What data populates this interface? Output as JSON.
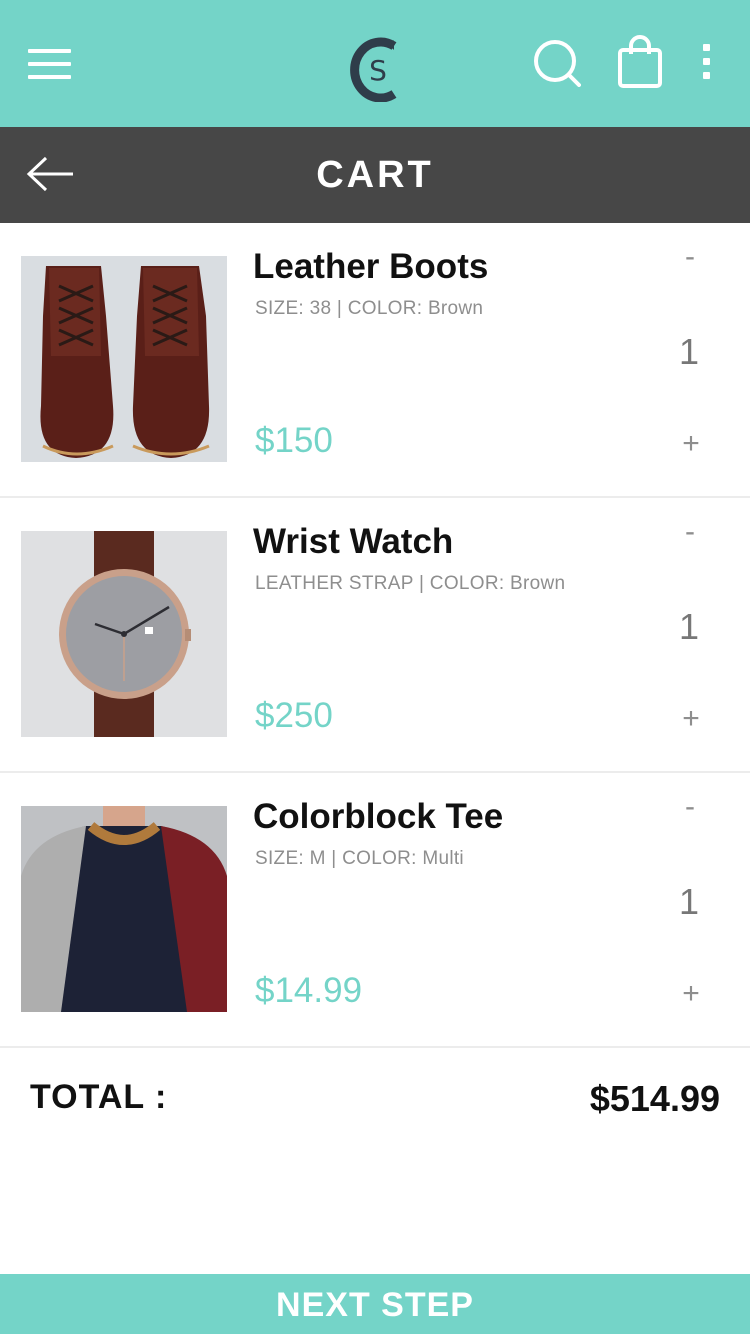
{
  "header": {
    "menu_icon": "hamburger-menu-icon",
    "logo_text": "S",
    "search_icon": "search-icon",
    "bag_icon": "shopping-bag-icon",
    "more_icon": "more-vertical-icon"
  },
  "titlebar": {
    "back_icon": "arrow-left-icon",
    "title": "CART"
  },
  "cart": {
    "items": [
      {
        "name": "Leather Boots",
        "meta": "SIZE: 38 | COLOR: Brown",
        "price": "$150",
        "quantity": "1",
        "minus": "-",
        "plus": "+"
      },
      {
        "name": "Wrist Watch",
        "meta": "LEATHER STRAP | COLOR: Brown",
        "price": "$250",
        "quantity": "1",
        "minus": "-",
        "plus": "+"
      },
      {
        "name": "Colorblock Tee",
        "meta": "SIZE: M | COLOR: Multi",
        "price": "$14.99",
        "quantity": "1",
        "minus": "-",
        "plus": "+"
      }
    ]
  },
  "summary": {
    "total_label": "TOTAL :",
    "total_value": "$514.99"
  },
  "footer": {
    "next_label": "NEXT STEP"
  },
  "colors": {
    "accent": "#74d4c8",
    "titlebar": "#474747",
    "text": "#111111",
    "muted": "#8e8e8e"
  }
}
